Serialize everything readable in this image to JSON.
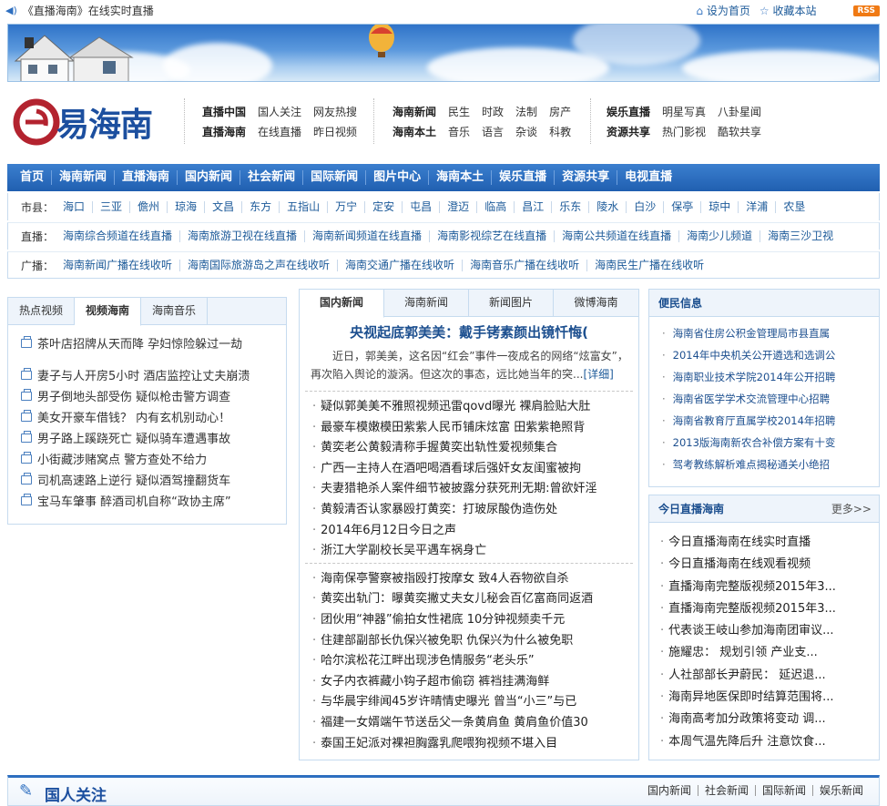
{
  "topbar": {
    "tagline": "《直播海南》在线实时直播",
    "home": "设为首页",
    "fav": "收藏本站",
    "rss": "RSS"
  },
  "logo": {
    "text": "易海南"
  },
  "nav_groups": [
    {
      "rows": [
        [
          "直播中国",
          "国人关注",
          "网友热搜"
        ],
        [
          "直播海南",
          "在线直播",
          "昨日视频"
        ]
      ]
    },
    {
      "rows": [
        [
          "海南新闻",
          "民生",
          "时政",
          "法制",
          "房产"
        ],
        [
          "海南本土",
          "音乐",
          "语言",
          "杂谈",
          "科教"
        ]
      ]
    },
    {
      "rows": [
        [
          "娱乐直播",
          "明星写真",
          "八卦星闻"
        ],
        [
          "资源共享",
          "热门影视",
          "酷软共享"
        ]
      ]
    }
  ],
  "mainnav": [
    "首页",
    "海南新闻",
    "直播海南",
    "国内新闻",
    "社会新闻",
    "国际新闻",
    "图片中心",
    "海南本土",
    "娱乐直播",
    "资源共享",
    "电视直播"
  ],
  "cities": {
    "label": "市县：",
    "items": [
      "海口",
      "三亚",
      "儋州",
      "琼海",
      "文昌",
      "东方",
      "五指山",
      "万宁",
      "定安",
      "屯昌",
      "澄迈",
      "临高",
      "昌江",
      "乐东",
      "陵水",
      "白沙",
      "保亭",
      "琼中",
      "洋浦",
      "农垦"
    ]
  },
  "tv": {
    "label": "直播：",
    "items": [
      "海南综合频道在线直播",
      "海南旅游卫视在线直播",
      "海南新闻频道在线直播",
      "海南影视综艺在线直播",
      "海南公共频道在线直播",
      "海南少儿频道",
      "海南三沙卫视"
    ]
  },
  "radio": {
    "label": "广播：",
    "items": [
      "海南新闻广播在线收听",
      "海南国际旅游岛之声在线收听",
      "海南交通广播在线收听",
      "海南音乐广播在线收听",
      "海南民生广播在线收听"
    ]
  },
  "left": {
    "tabs": [
      "热点视频",
      "视频海南",
      "海南音乐"
    ],
    "first": "茶叶店招牌从天而降 孕妇惊险躲过一劫",
    "items": [
      "妻子与人开房5小时 酒店监控让丈夫崩溃",
      "男子倒地头部受伤 疑似枪击警方调查",
      "美女开豪车借钱？ 内有玄机别动心！",
      "男子路上蹊跷死亡 疑似骑车遭遇事故",
      "小街藏涉赌窝点 警方查处不给力",
      "司机高速路上逆行 疑似酒驾撞翻货车",
      "宝马车肇事 醉酒司机自称“政协主席”"
    ]
  },
  "center": {
    "tabs": [
      "国内新闻",
      "海南新闻",
      "新闻图片",
      "微博海南"
    ],
    "headline": "央视起底郭美美：戴手铐素颜出镜忏悔(",
    "summary": "近日，郭美美，这名因“红会”事件一夜成名的网络“炫富女”，再次陷入舆论的漩涡。但这次的事态，远比她当年的突...",
    "more": "[详细]",
    "list1": [
      "疑似郭美美不雅照视频迅雷qovd曝光 裸肩脸贴大肚",
      "最豪车模嫩模田紫紫人民币铺床炫富 田紫紫艳照背",
      "黄奕老公黄毅清称手握黄奕出轨性爱视频集合",
      "广西一主持人在酒吧喝酒看球后强奸女友闺蜜被拘",
      "夫妻猎艳杀人案件细节被披露分获死刑无期:曾欲奸淫",
      "黄毅清否认家暴殴打黄奕：打玻尿酸伪造伤处",
      "2014年6月12日今日之声",
      "浙江大学副校长吴平遇车祸身亡"
    ],
    "list2": [
      "海南保亭警察被指殴打按摩女 致4人吞物欲自杀",
      "黄奕出轨门：曝黄奕撇丈夫女儿秘会百亿富商同返酒",
      "团伙用“神器”偷拍女性裙底 10分钟视频卖千元",
      "住建部副部长仇保兴被免职 仇保兴为什么被免职",
      "哈尔滨松花江畔出现涉色情服务“老头乐”",
      "女子内衣裤藏小钩子超市偷窃 裤裆挂满海鲜",
      "与华晨宇绯闻45岁许晴情史曝光 曾当“小三”与已",
      "福建一女婿端午节送岳父一条黄肩鱼 黄肩鱼价值30",
      "泰国王妃派对裸袒胸露乳爬喂狗视频不堪入目"
    ]
  },
  "right": {
    "title": "便民信息",
    "items": [
      "海南省住房公积金管理局市县直属",
      "2014年中央机关公开遴选和选调公",
      "海南职业技术学院2014年公开招聘",
      "海南省医学学术交流管理中心招聘",
      "海南省教育厅直属学校2014年招聘",
      "2013版海南新农合补偿方案有十变",
      "驾考教练解析难点揭秘通关小绝招"
    ]
  },
  "right2": {
    "title": "今日直播海南",
    "more": "更多>>",
    "items": [
      "今日直播海南在线实时直播",
      "今日直播海南在线观看视频",
      "直播海南完整版视频2015年3...",
      "直播海南完整版视频2015年3...",
      "代表谈王岐山参加海南团审议...",
      "施耀忠： 规划引领 产业支...",
      "人社部部长尹蔚民： 延迟退...",
      "海南异地医保即时结算范围将...",
      "海南高考加分政策将变动 调...",
      "本周气温先降后升 注意饮食..."
    ]
  },
  "bottom": {
    "title": "国人关注",
    "links": [
      "国内新闻",
      "社会新闻",
      "国际新闻",
      "娱乐新闻"
    ]
  }
}
